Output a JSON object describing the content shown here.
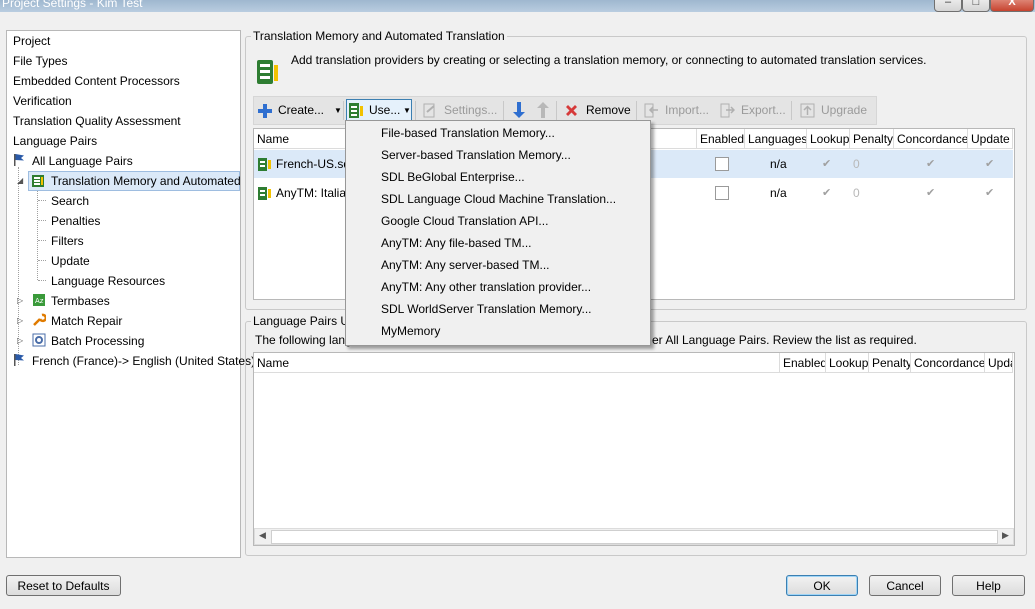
{
  "window": {
    "title": "Project Settings - Kim Test",
    "minimize": "–",
    "maximize": "□",
    "close": "X"
  },
  "tree": {
    "items": [
      {
        "label": "Project"
      },
      {
        "label": "File Types"
      },
      {
        "label": "Embedded Content Processors"
      },
      {
        "label": "Verification"
      },
      {
        "label": "Translation Quality Assessment"
      },
      {
        "label": "Language Pairs"
      },
      {
        "label": "All Language Pairs"
      },
      {
        "label": "Translation Memory and Automated"
      },
      {
        "label": "Search"
      },
      {
        "label": "Penalties"
      },
      {
        "label": "Filters"
      },
      {
        "label": "Update"
      },
      {
        "label": "Language Resources"
      },
      {
        "label": "Termbases"
      },
      {
        "label": "Match Repair"
      },
      {
        "label": "Batch Processing"
      },
      {
        "label": "French (France)-> English (United States)"
      }
    ]
  },
  "tm_group": {
    "title": "Translation Memory and Automated Translation",
    "description": "Add translation providers by creating or selecting a translation memory, or connecting to automated translation services."
  },
  "toolbar": {
    "create": "Create...",
    "use": "Use...",
    "settings": "Settings...",
    "remove": "Remove",
    "import": "Import...",
    "export": "Export...",
    "upgrade": "Upgrade"
  },
  "tm_grid": {
    "columns": [
      "Name",
      "Enabled",
      "Languages",
      "Lookup",
      "Penalty",
      "Concordance",
      "Update"
    ],
    "rows": [
      {
        "name": "French-US.sdl",
        "languages": "n/a",
        "lookup": "✔",
        "penalty": "0",
        "concordance": "✔",
        "update": "✔"
      },
      {
        "name": "AnyTM: Italian",
        "languages": "n/a",
        "lookup": "✔",
        "penalty": "0",
        "concordance": "✔",
        "update": "✔"
      }
    ]
  },
  "use_menu": {
    "items": [
      "File-based Translation Memory...",
      "Server-based Translation Memory...",
      "SDL BeGlobal Enterprise...",
      "SDL Language Cloud Machine Translation...",
      "Google Cloud Translation API...",
      "AnyTM: Any file-based TM...",
      "AnyTM: Any server-based TM...",
      "AnyTM: Any other translation provider...",
      "SDL WorldServer Translation Memory...",
      "MyMemory"
    ]
  },
  "lp_group": {
    "title": "Language Pairs Us",
    "description_start": "The following lang",
    "description_end": "er All Language Pairs. Review the list as required."
  },
  "lp_grid": {
    "columns": [
      "Name",
      "Enabled",
      "Lookup",
      "Penalty",
      "Concordance",
      "Upda"
    ]
  },
  "footer": {
    "reset": "Reset to Defaults",
    "ok": "OK",
    "cancel": "Cancel",
    "help": "Help"
  }
}
